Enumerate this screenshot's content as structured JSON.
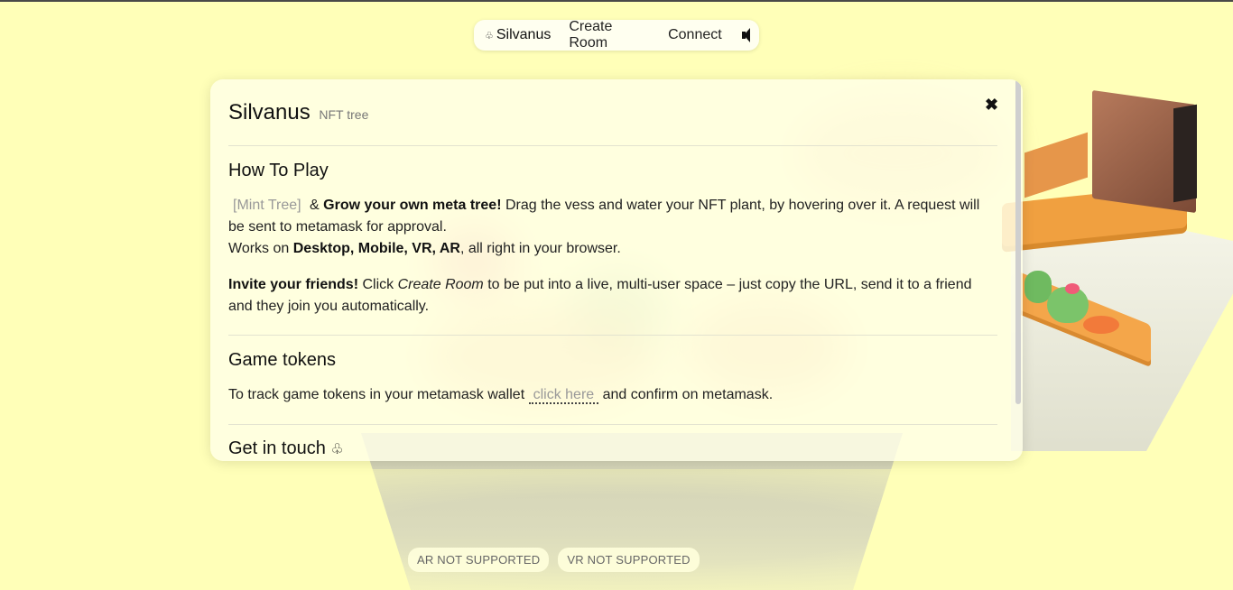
{
  "nav": {
    "brand_icon": "tree-icon",
    "brand": "Silvanus",
    "create_room": "Create Room",
    "connect": "Connect",
    "sound_icon": "speaker-icon"
  },
  "panel": {
    "title": "Silvanus",
    "subtitle": "NFT tree",
    "close": "✖",
    "how_to_play": {
      "heading": "How To Play",
      "mint_button": "[Mint Tree]",
      "amp": "&",
      "grow": "Grow your own meta tree!",
      "grow_text": "Drag the vess and water your NFT plant, by hovering over it. A request will be sent to metamask for approval.",
      "works_on_prefix": "Works on",
      "platforms": "Desktop, Mobile, VR, AR",
      "works_on_suffix": ", all right in your browser.",
      "invite": "Invite your friends!",
      "invite_click": "Click",
      "create_room": "Create Room",
      "invite_text": "to be put into a live, multi-user space – just copy the URL, send it to a friend and they join you automatically."
    },
    "game_tokens": {
      "heading": "Game tokens",
      "text_before": "To track game tokens in your metamask wallet",
      "link": "click here",
      "text_after": "and confirm on metamask."
    },
    "get_in_touch": {
      "heading": "Get in touch",
      "icon": "tree-icon"
    }
  },
  "badges": {
    "ar": "AR NOT SUPPORTED",
    "vr": "VR NOT SUPPORTED"
  },
  "colors": {
    "background": "#ffffb8",
    "panel": "#ffffe8"
  }
}
